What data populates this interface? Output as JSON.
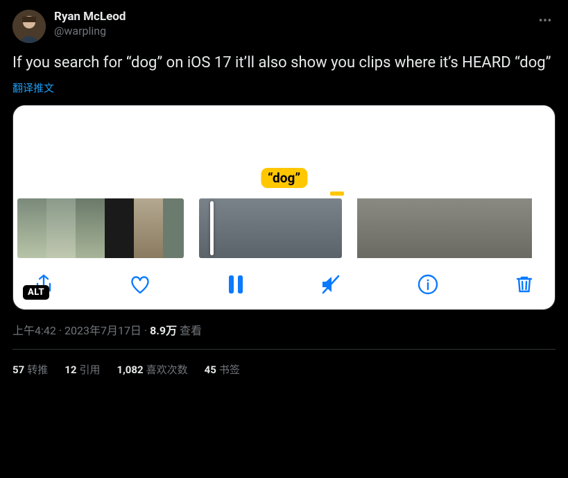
{
  "author": {
    "display_name": "Ryan McLeod",
    "handle": "@warpling"
  },
  "tweet_text": "If you search for “dog” on iOS 17 it’ll also show you clips where it’s HEARD “dog”",
  "translate_label": "翻译推文",
  "media": {
    "badge_text": "“dog”",
    "alt_label": "ALT",
    "toolbar": {
      "share": "share",
      "like": "like",
      "pause": "pause",
      "mute": "mute",
      "info": "info",
      "trash": "trash"
    }
  },
  "meta": {
    "time": "上午4:42",
    "sep1": " · ",
    "date": "2023年7月17日",
    "sep2": " · ",
    "views_count": "8.9万",
    "views_label": " 查看"
  },
  "stats": {
    "retweets_n": "57",
    "retweets_l": "转推",
    "quotes_n": "12",
    "quotes_l": "引用",
    "likes_n": "1,082",
    "likes_l": "喜欢次数",
    "bookmarks_n": "45",
    "bookmarks_l": "书签"
  }
}
